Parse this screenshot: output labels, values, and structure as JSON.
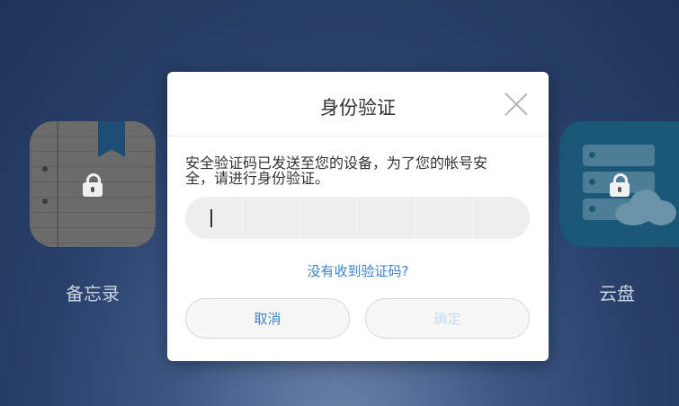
{
  "background_apps": {
    "left": {
      "label": "备忘录",
      "icon": "notes-app-icon"
    },
    "right": {
      "label": "云盘",
      "icon": "cloud-drive-app-icon"
    }
  },
  "dialog": {
    "title": "身份验证",
    "close_icon": "close-icon",
    "message": "安全验证码已发送至您的设备，为了您的帐号安全，请进行身份验证。",
    "code_input": {
      "value": "",
      "length": 6
    },
    "resend_link": "没有收到验证码?",
    "cancel_button": "取消",
    "confirm_button": "确定"
  },
  "colors": {
    "link_blue": "#3d83c7",
    "disabled_blue": "#c4dcef",
    "background_navy": "#283f69"
  }
}
